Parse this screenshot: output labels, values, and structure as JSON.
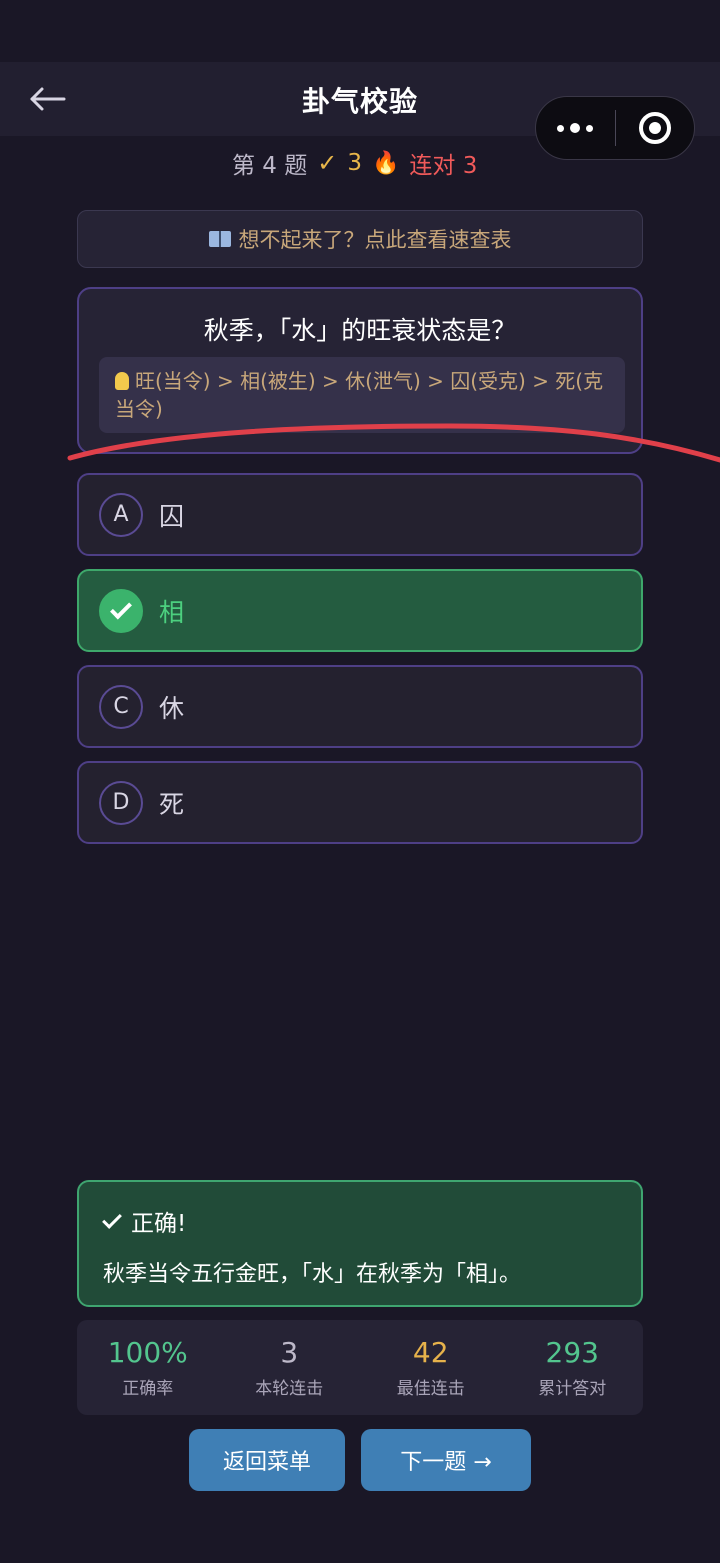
{
  "header": {
    "title": "卦气校验",
    "back_icon": "arrow-left-icon"
  },
  "status": {
    "question_label": "第 4 题",
    "correct_count": "3",
    "streak_label": "连对 3"
  },
  "cheat_sheet": {
    "label": "想不起来了？点此查看速查表"
  },
  "question": {
    "text": "秋季，「水」的旺衰状态是？",
    "hint": "旺(当令) > 相(被生) > 休(泄气) > 囚(受克) > 死(克当令)"
  },
  "options": [
    {
      "letter": "A",
      "text": "囚",
      "state": "normal"
    },
    {
      "letter": "B",
      "text": "相",
      "state": "correct"
    },
    {
      "letter": "C",
      "text": "休",
      "state": "normal"
    },
    {
      "letter": "D",
      "text": "死",
      "state": "normal"
    }
  ],
  "feedback": {
    "title": "正确!",
    "body": "秋季当令五行金旺，「水」在秋季为「相」。"
  },
  "stats": [
    {
      "value": "100%",
      "label": "正确率"
    },
    {
      "value": "3",
      "label": "本轮连击"
    },
    {
      "value": "42",
      "label": "最佳连击"
    },
    {
      "value": "293",
      "label": "累计答对"
    }
  ],
  "buttons": {
    "menu": "返回菜单",
    "next": "下一题 →"
  },
  "colors": {
    "accent_border": "#4e3f86",
    "correct": "#3bb36c",
    "button": "#3f7fb5",
    "annotation_red": "#e0404a"
  }
}
